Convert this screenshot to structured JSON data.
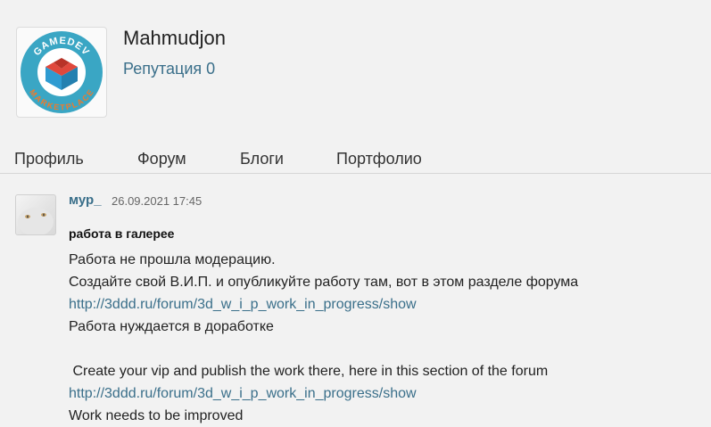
{
  "profile": {
    "username": "Mahmudjon",
    "reputation": "Репутация 0",
    "logo": {
      "top_text": "GAMEDEV",
      "bottom_text": "MARKETPLACE",
      "colors": {
        "ring": "#3aa6c4",
        "cube_red": "#e0483c",
        "cube_blue": "#2f9bd1",
        "text": "#ffffff"
      }
    }
  },
  "tabs": [
    {
      "label": "Профиль"
    },
    {
      "label": "Форум"
    },
    {
      "label": "Блоги"
    },
    {
      "label": "Портфолио"
    }
  ],
  "post": {
    "author": "мур_",
    "date": "26.09.2021 17:45",
    "subject": "работа в галерее",
    "lines": [
      "Работа не прошла модерацию.",
      "Создайте свой В.И.П. и опубликуйте работу там, вот в этом разделе форума",
      "http://3ddd.ru/forum/3d_w_i_p_work_in_progress/show",
      "Работа нуждается в доработке",
      "",
      " Create your vip and publish the work there, here in this section of the forum",
      "http://3ddd.ru/forum/3d_w_i_p_work_in_progress/show",
      "Work needs to be improved"
    ]
  },
  "colors": {
    "link": "#3a6f8a",
    "background": "#f2f2f2"
  }
}
